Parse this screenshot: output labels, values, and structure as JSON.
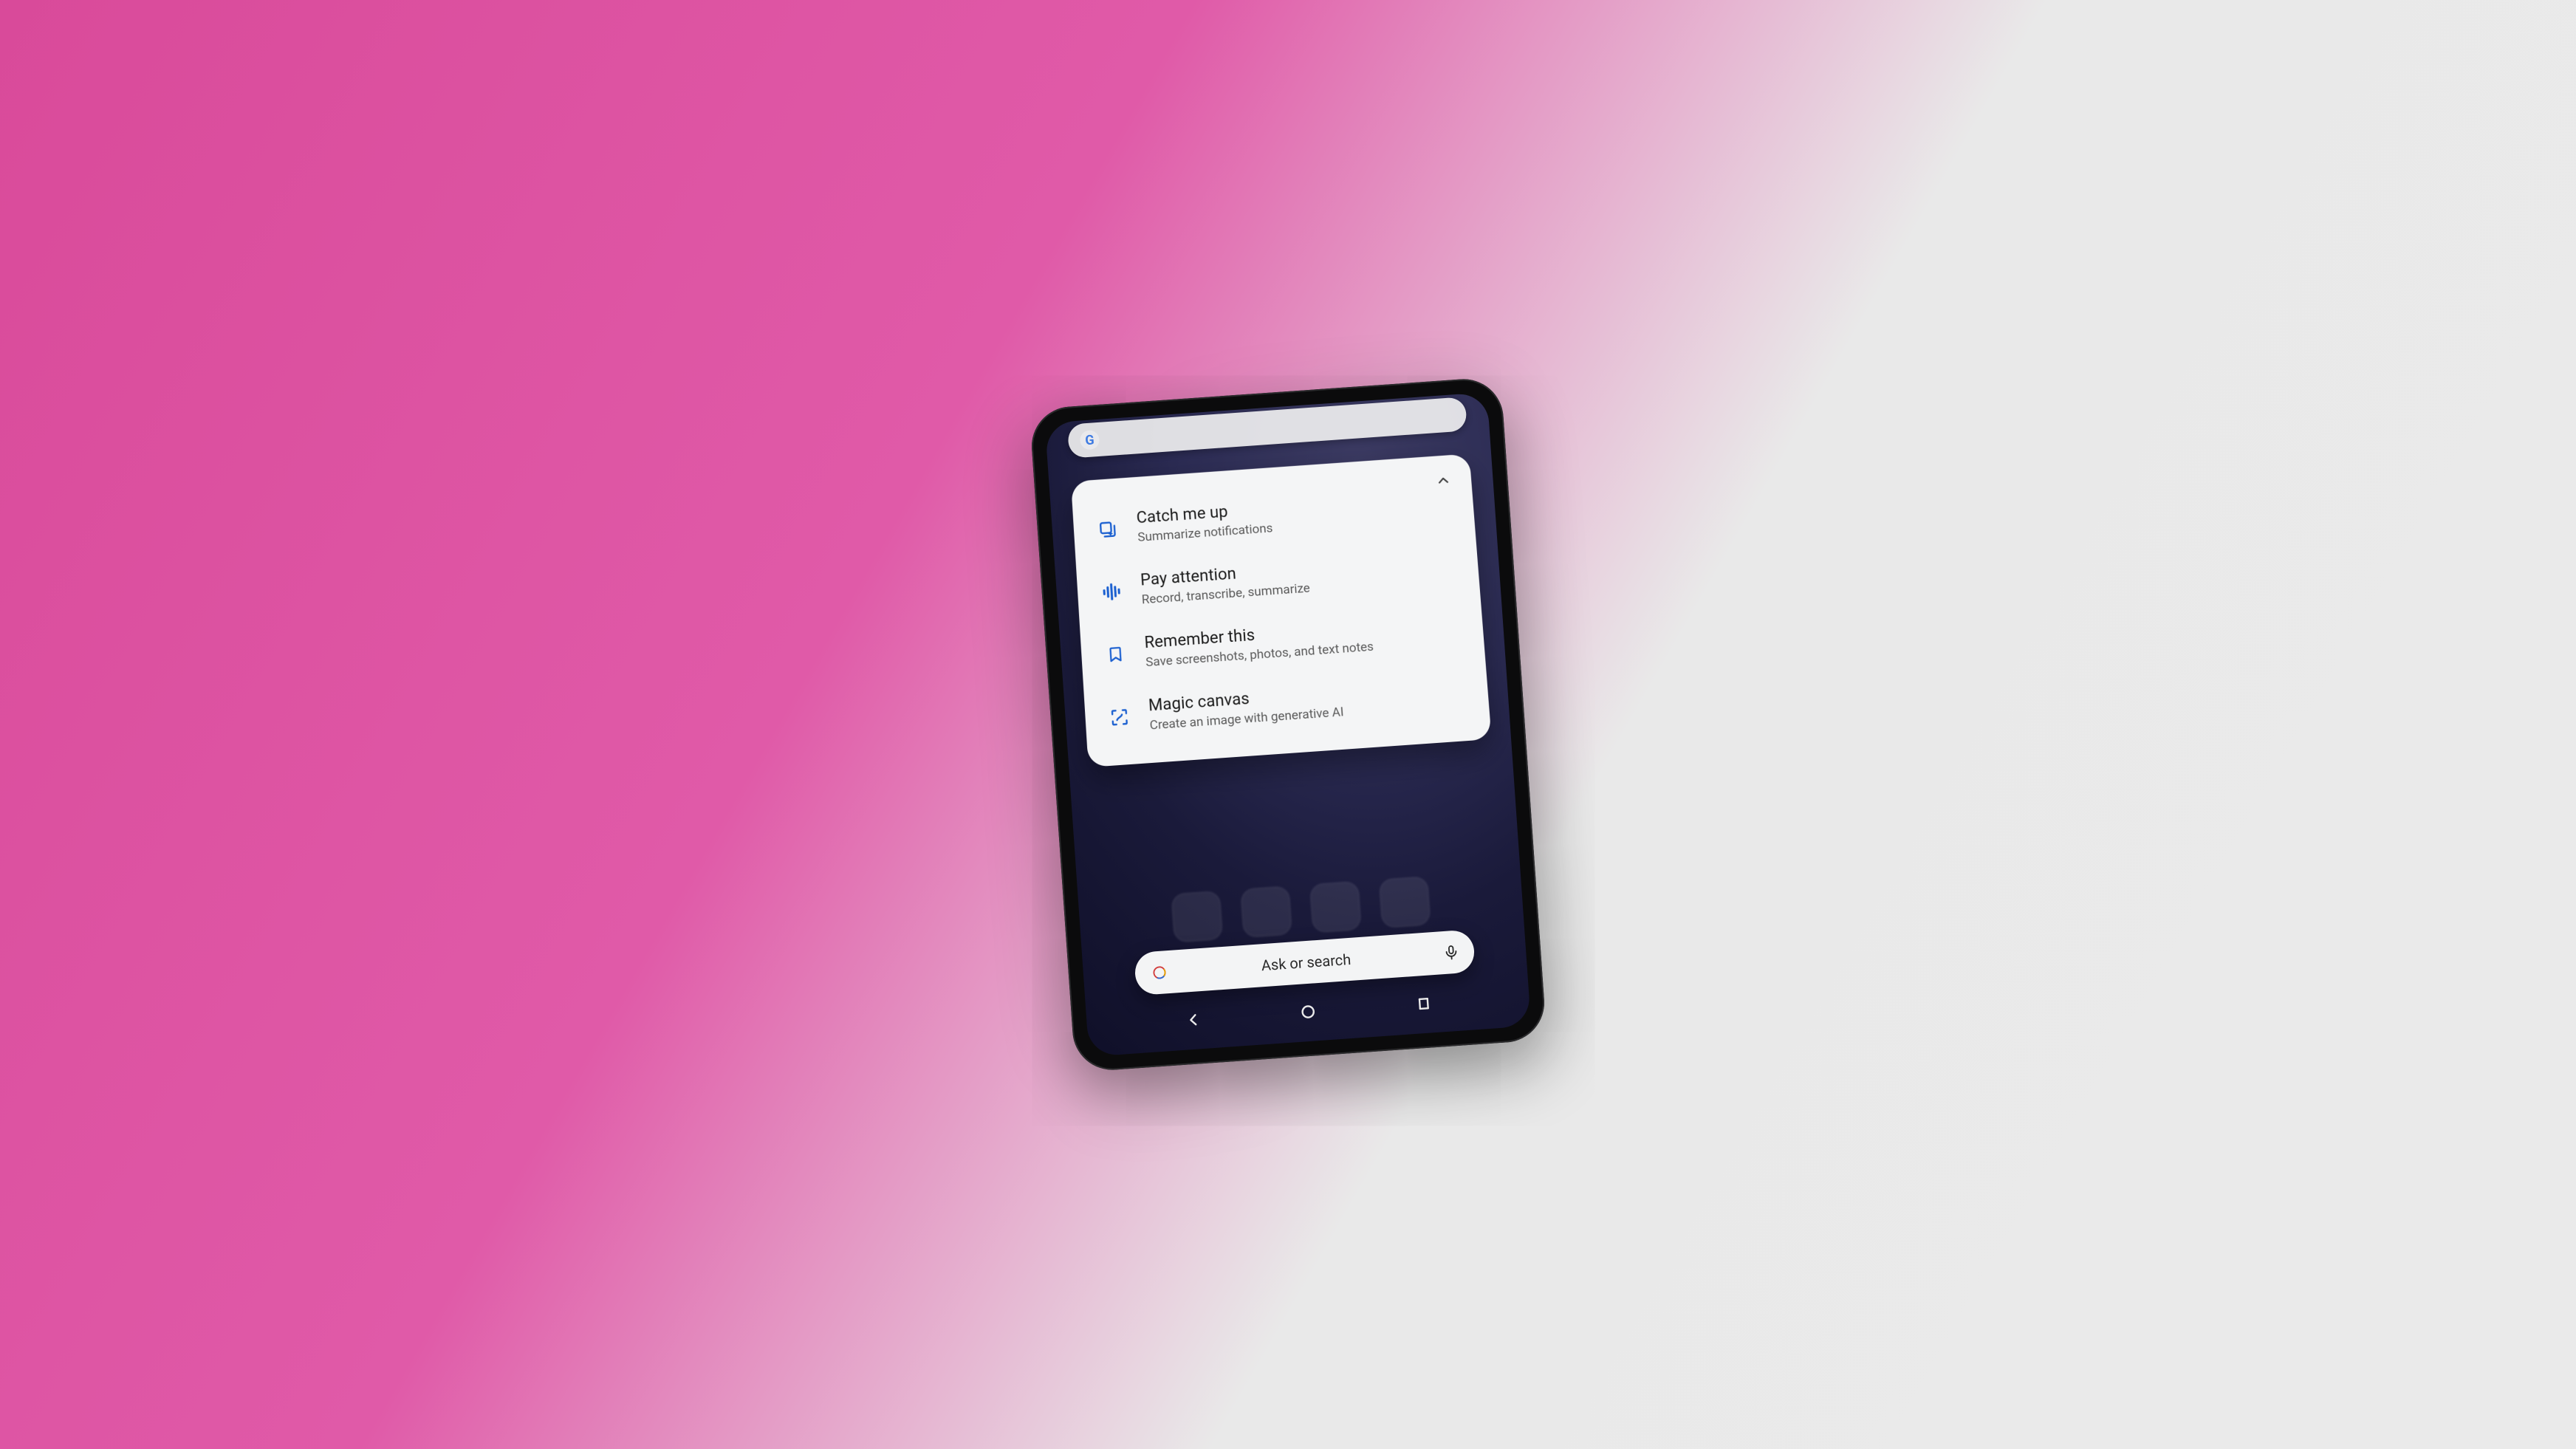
{
  "card": {
    "items": [
      {
        "icon": "stack-sparkle-icon",
        "title": "Catch me up",
        "subtitle": "Summarize notifications"
      },
      {
        "icon": "waveform-icon",
        "title": "Pay attention",
        "subtitle": "Record, transcribe, summarize"
      },
      {
        "icon": "bookmark-icon",
        "title": "Remember this",
        "subtitle": "Save screenshots, photos, and text notes"
      },
      {
        "icon": "scan-sparkle-icon",
        "title": "Magic canvas",
        "subtitle": "Create an image with generative AI"
      }
    ]
  },
  "search": {
    "placeholder": "Ask or search"
  },
  "colors": {
    "icon_blue": "#1a5fd0",
    "card_bg": "#f4f5f6",
    "text_primary": "#1a1a1a",
    "text_secondary": "#5a5a5a"
  }
}
